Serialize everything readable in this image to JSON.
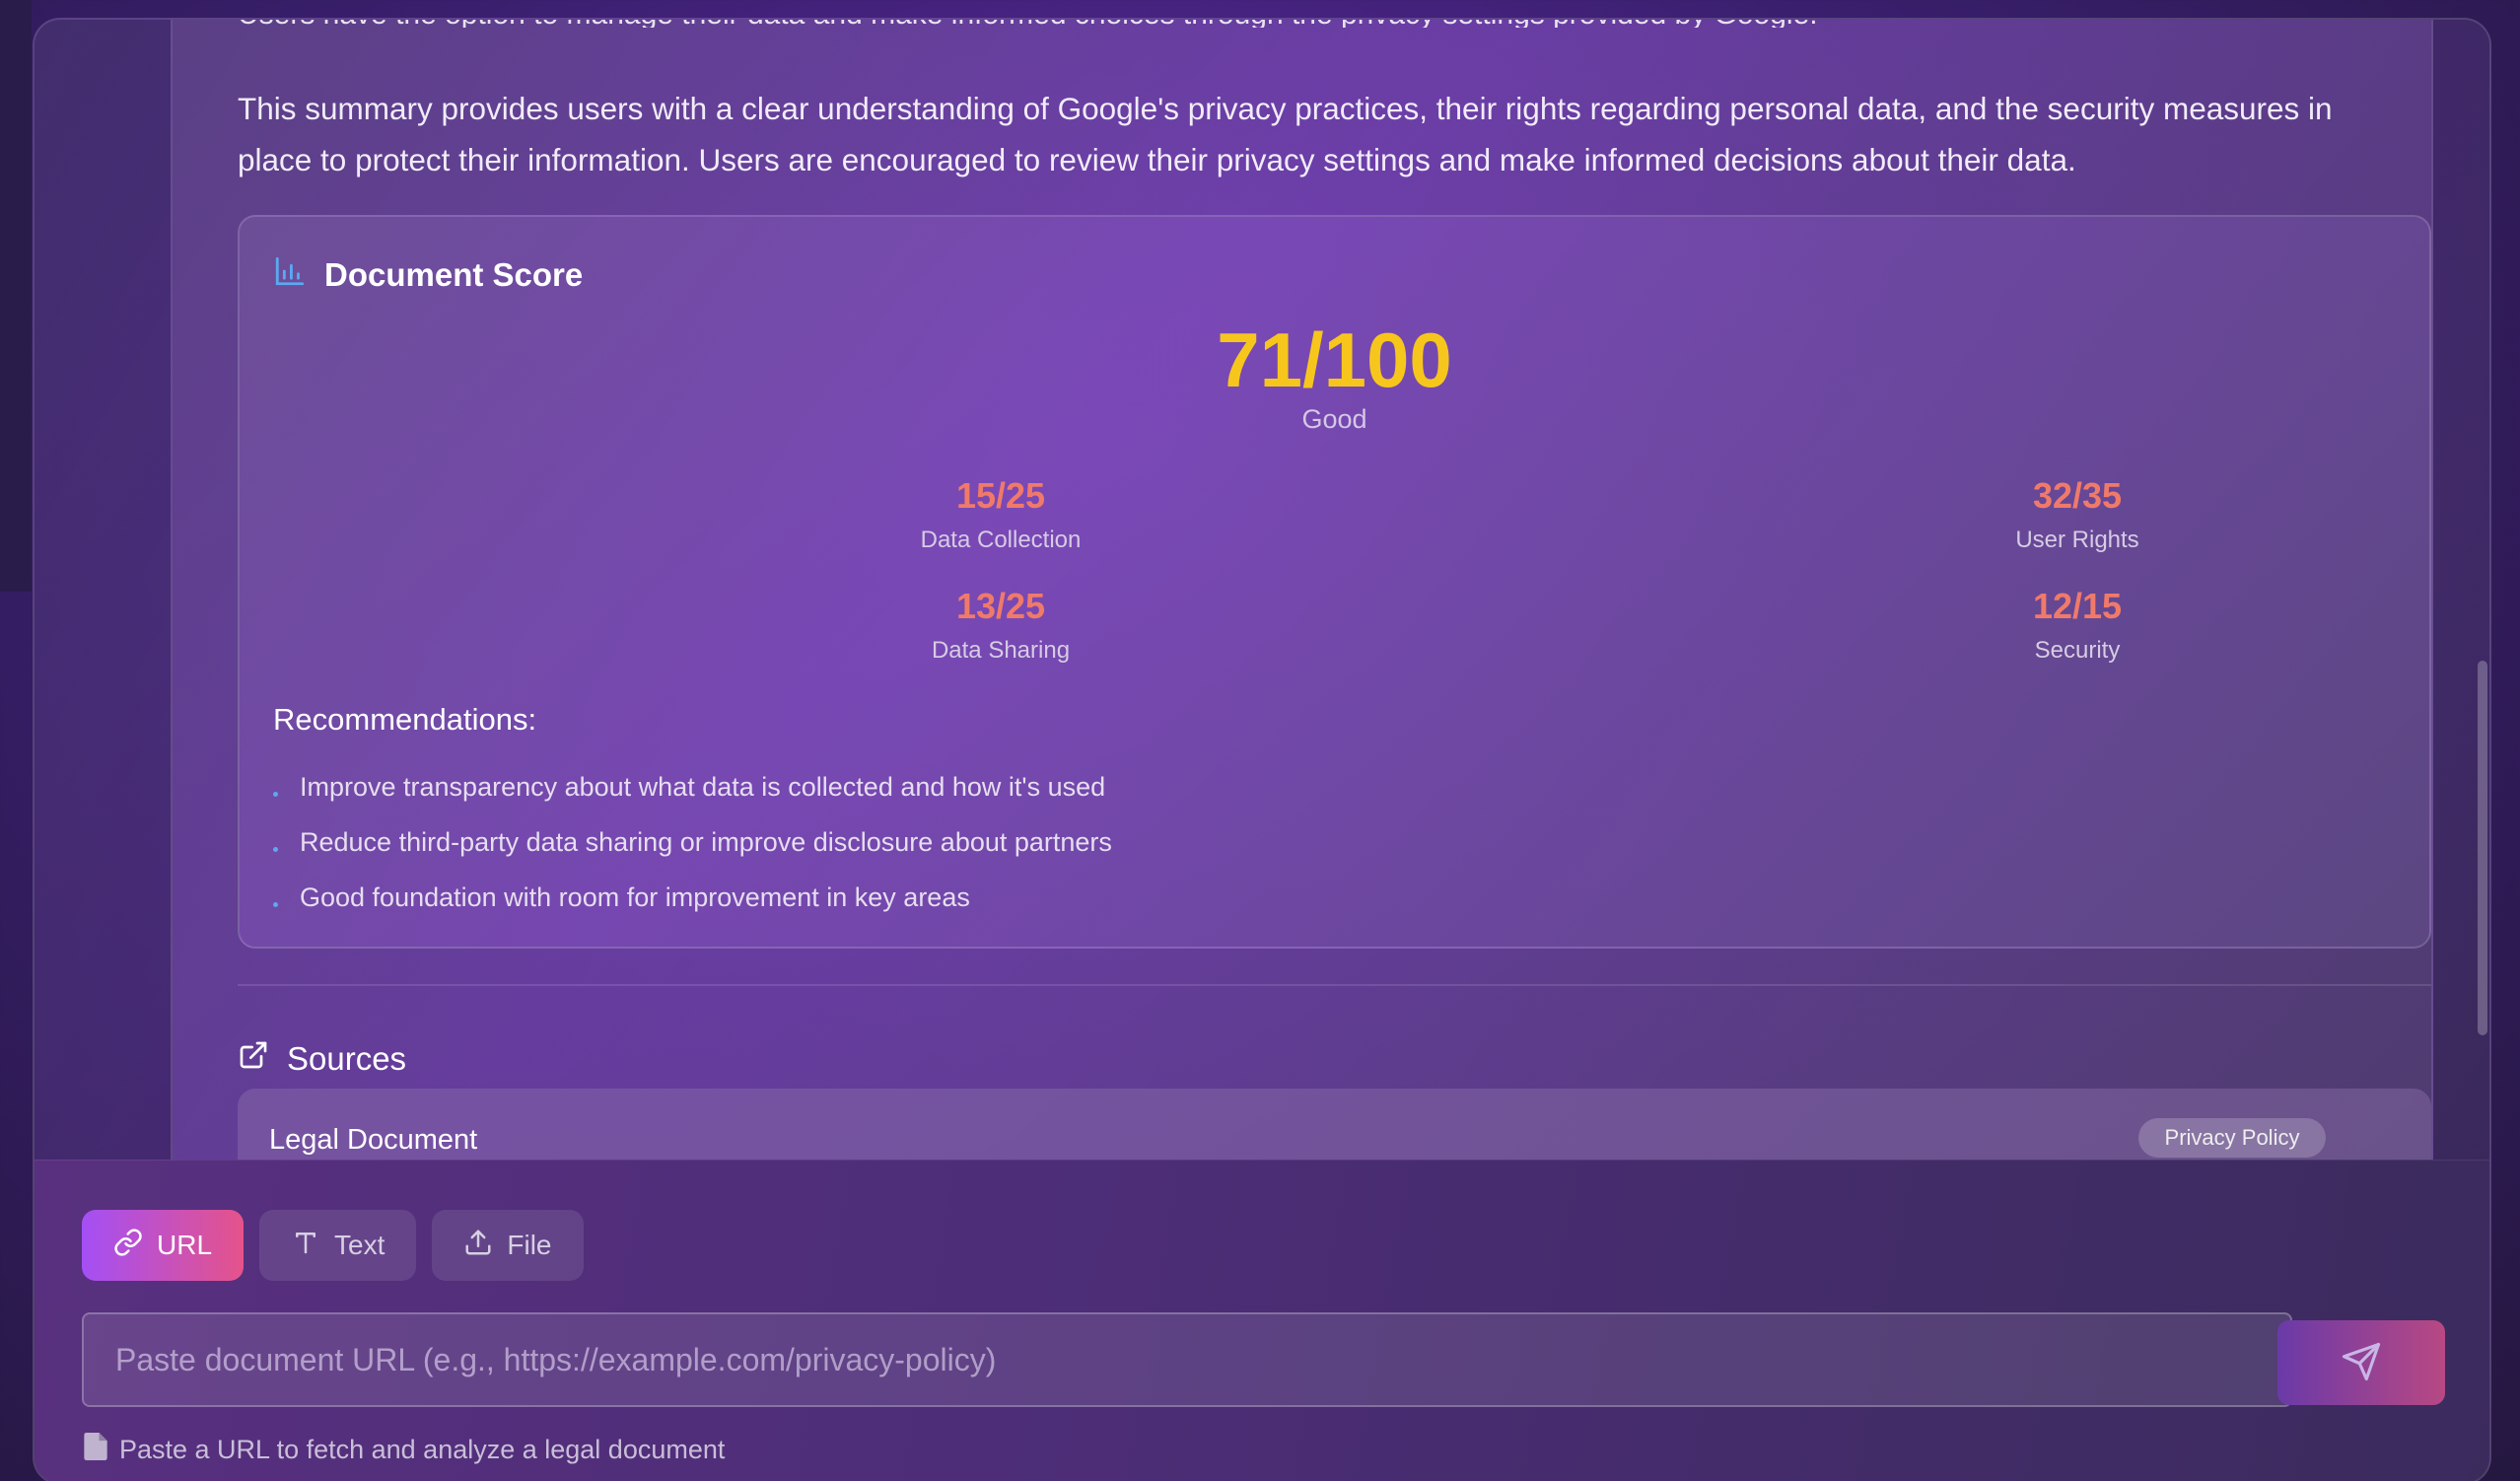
{
  "summary": {
    "partial_line": "Users have the option to manage their data and make informed choices through the privacy settings provided by Google.",
    "text": "This summary provides users with a clear understanding of Google's privacy practices, their rights regarding personal data, and the security measures in place to protect their information. Users are encouraged to review their privacy settings and make informed decisions about their data."
  },
  "score": {
    "heading": "Document Score",
    "icon": "bar-chart-icon",
    "total": "71/100",
    "rating": "Good",
    "total_color": "#f7c61d",
    "sub_color": "#f07a6a",
    "categories": [
      {
        "value": "15/25",
        "label": "Data Collection"
      },
      {
        "value": "32/35",
        "label": "User Rights"
      },
      {
        "value": "13/25",
        "label": "Data Sharing"
      },
      {
        "value": "12/15",
        "label": "Security"
      }
    ],
    "recommendations_title": "Recommendations:",
    "recommendations": [
      "Improve transparency about what data is collected and how it's used",
      "Reduce third-party data sharing or improve disclosure about partners",
      "Good foundation with room for improvement in key areas"
    ]
  },
  "sources": {
    "heading": "Sources",
    "icon": "external-link-icon",
    "items": [
      {
        "title": "Legal Document",
        "badge": "Privacy Policy"
      }
    ]
  },
  "input_panel": {
    "modes": [
      {
        "label": "URL",
        "icon": "link-icon",
        "active": true
      },
      {
        "label": "Text",
        "icon": "text-icon",
        "active": false
      },
      {
        "label": "File",
        "icon": "upload-icon",
        "active": false
      }
    ],
    "placeholder": "Paste document URL (e.g., https://example.com/privacy-policy)",
    "hint": "Paste a URL to fetch and analyze a legal document",
    "send_icon": "send-icon",
    "accent_gradient": [
      "#a44ff5",
      "#e5538a"
    ]
  }
}
